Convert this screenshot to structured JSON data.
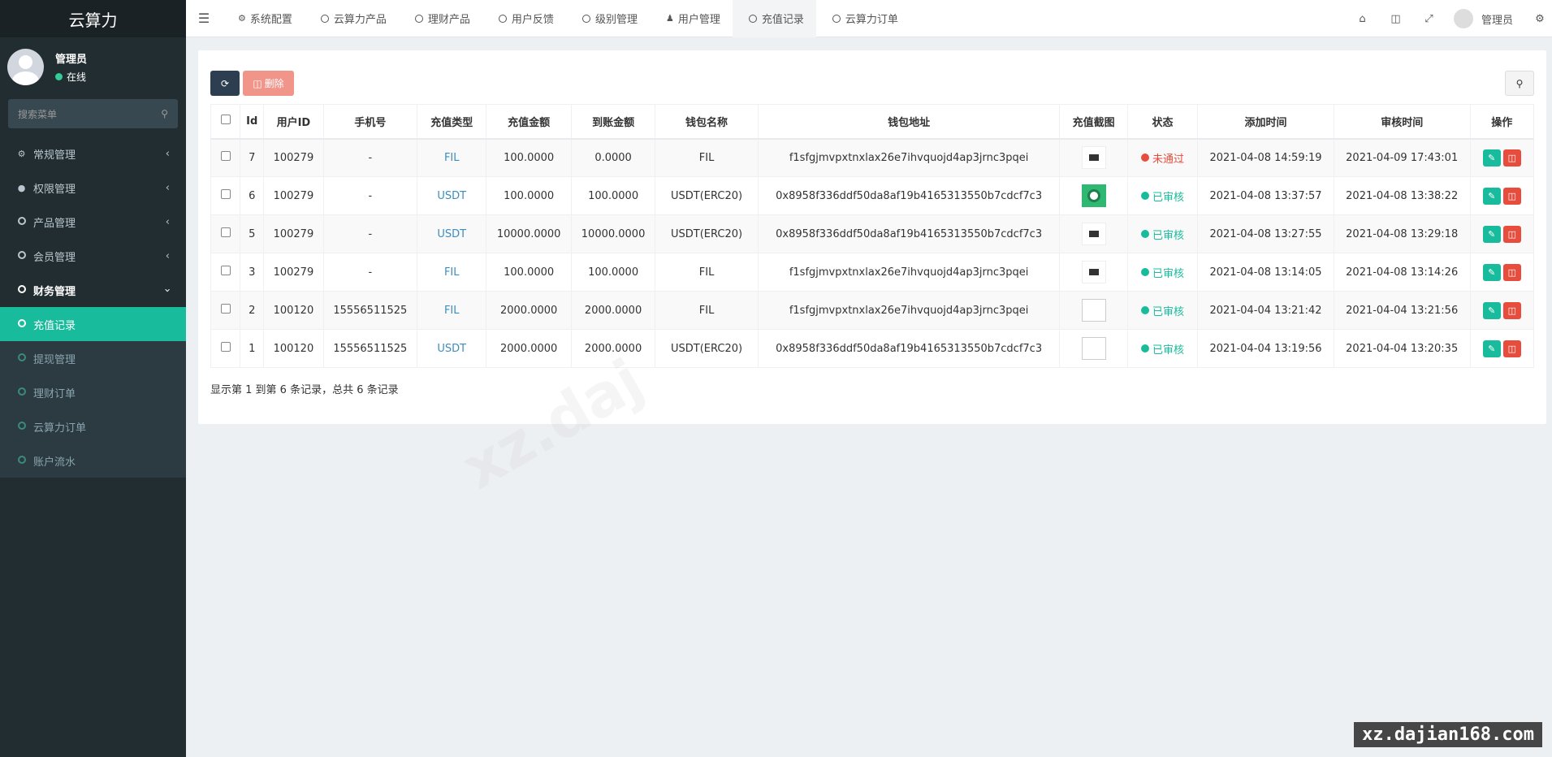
{
  "app": {
    "title": "云算力"
  },
  "user": {
    "name": "管理员",
    "status": "在线"
  },
  "sidebar": {
    "search_placeholder": "搜索菜单",
    "items": [
      {
        "label": "常规管理",
        "icon": "cogs-icon"
      },
      {
        "label": "权限管理",
        "icon": "group-icon"
      },
      {
        "label": "产品管理",
        "icon": "circle-icon"
      },
      {
        "label": "会员管理",
        "icon": "circle-icon"
      },
      {
        "label": "财务管理",
        "icon": "circle-icon"
      }
    ],
    "subitems": [
      {
        "label": "充值记录"
      },
      {
        "label": "提现管理"
      },
      {
        "label": "理财订单"
      },
      {
        "label": "云算力订单"
      },
      {
        "label": "账户流水"
      }
    ]
  },
  "header": {
    "tabs": [
      {
        "label": "系统配置"
      },
      {
        "label": "云算力产品"
      },
      {
        "label": "理财产品"
      },
      {
        "label": "用户反馈"
      },
      {
        "label": "级别管理"
      },
      {
        "label": "用户管理"
      },
      {
        "label": "充值记录"
      },
      {
        "label": "云算力订单"
      }
    ],
    "admin_name": "管理员"
  },
  "toolbar": {
    "delete_label": "删除"
  },
  "table": {
    "headers": [
      "Id",
      "用户ID",
      "手机号",
      "充值类型",
      "充值金额",
      "到账金额",
      "钱包名称",
      "钱包地址",
      "充值截图",
      "状态",
      "添加时间",
      "审核时间",
      "操作"
    ],
    "rows": [
      {
        "id": "7",
        "uid": "100279",
        "phone": "-",
        "type": "FIL",
        "amount": "100.0000",
        "credited": "0.0000",
        "wallet": "FIL",
        "address": "f1sfgjmvpxtnxlax26e7ihvquojd4ap3jrnc3pqei",
        "status": "未通过",
        "added": "2021-04-08 14:59:19",
        "reviewed": "2021-04-09 17:43:01"
      },
      {
        "id": "6",
        "uid": "100279",
        "phone": "-",
        "type": "USDT",
        "amount": "100.0000",
        "credited": "100.0000",
        "wallet": "USDT(ERC20)",
        "address": "0x8958f336ddf50da8af19b4165313550b7cdcf7c3",
        "status": "已审核",
        "added": "2021-04-08 13:37:57",
        "reviewed": "2021-04-08 13:38:22"
      },
      {
        "id": "5",
        "uid": "100279",
        "phone": "-",
        "type": "USDT",
        "amount": "10000.0000",
        "credited": "10000.0000",
        "wallet": "USDT(ERC20)",
        "address": "0x8958f336ddf50da8af19b4165313550b7cdcf7c3",
        "status": "已审核",
        "added": "2021-04-08 13:27:55",
        "reviewed": "2021-04-08 13:29:18"
      },
      {
        "id": "3",
        "uid": "100279",
        "phone": "-",
        "type": "FIL",
        "amount": "100.0000",
        "credited": "100.0000",
        "wallet": "FIL",
        "address": "f1sfgjmvpxtnxlax26e7ihvquojd4ap3jrnc3pqei",
        "status": "已审核",
        "added": "2021-04-08 13:14:05",
        "reviewed": "2021-04-08 13:14:26"
      },
      {
        "id": "2",
        "uid": "100120",
        "phone": "15556511525",
        "type": "FIL",
        "amount": "2000.0000",
        "credited": "2000.0000",
        "wallet": "FIL",
        "address": "f1sfgjmvpxtnxlax26e7ihvquojd4ap3jrnc3pqei",
        "status": "已审核",
        "added": "2021-04-04 13:21:42",
        "reviewed": "2021-04-04 13:21:56"
      },
      {
        "id": "1",
        "uid": "100120",
        "phone": "15556511525",
        "type": "USDT",
        "amount": "2000.0000",
        "credited": "2000.0000",
        "wallet": "USDT(ERC20)",
        "address": "0x8958f336ddf50da8af19b4165313550b7cdcf7c3",
        "status": "已审核",
        "added": "2021-04-04 13:19:56",
        "reviewed": "2021-04-04 13:20:35"
      }
    ]
  },
  "pager": {
    "text": "显示第 1 到第 6 条记录，总共 6 条记录"
  },
  "watermark": {
    "text": "xz.dajian168.com",
    "faint": "xz.daj"
  },
  "colors": {
    "accent": "#18bc9c",
    "danger": "#e74c3c",
    "sidebar": "#222d32",
    "link": "#3c8dbc"
  }
}
